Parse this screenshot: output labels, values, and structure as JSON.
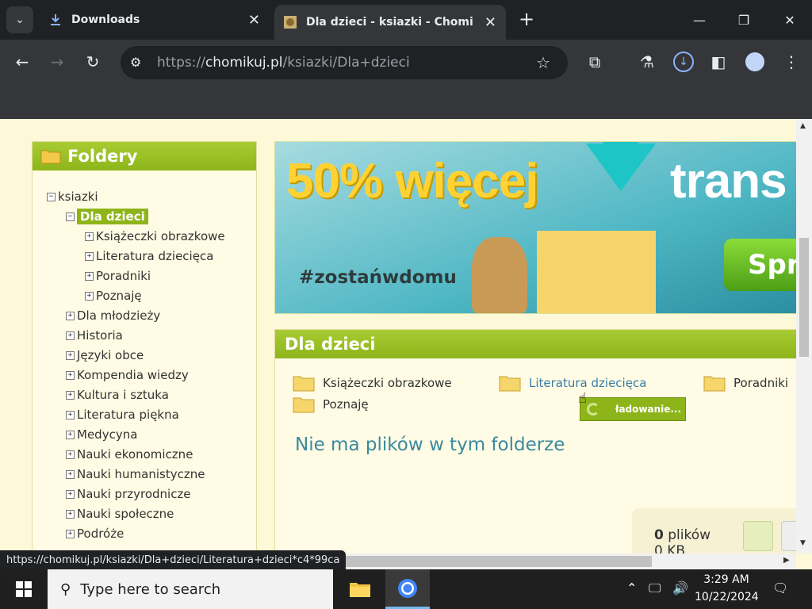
{
  "browser": {
    "tabs": [
      {
        "title": "Downloads"
      },
      {
        "title": "Dla dzieci - ksiazki - Chomikuj.pl"
      }
    ],
    "url_scheme": "https://",
    "url_host": "chomikuj.pl",
    "url_path": "/ksiazki/Dla+dzieci",
    "status_url": "https://chomikuj.pl/ksiazki/Dla+dzieci/Literatura+dzieci*c4*99ca"
  },
  "sidebar": {
    "title": "Foldery",
    "tree": [
      {
        "label": "ksiazki",
        "sign": "−"
      },
      {
        "label": "Dla dzieci",
        "sign": "−"
      },
      {
        "label": "Książeczki obrazkowe",
        "sign": "+"
      },
      {
        "label": "Literatura dziecięca",
        "sign": "+"
      },
      {
        "label": "Poradniki",
        "sign": "+"
      },
      {
        "label": "Poznaję",
        "sign": "+"
      },
      {
        "label": "Dla młodzieży",
        "sign": "+"
      },
      {
        "label": "Historia",
        "sign": "+"
      },
      {
        "label": "Języki obce",
        "sign": "+"
      },
      {
        "label": "Kompendia wiedzy",
        "sign": "+"
      },
      {
        "label": "Kultura i sztuka",
        "sign": "+"
      },
      {
        "label": "Literatura piękna",
        "sign": "+"
      },
      {
        "label": "Medycyna",
        "sign": "+"
      },
      {
        "label": "Nauki ekonomiczne",
        "sign": "+"
      },
      {
        "label": "Nauki humanistyczne",
        "sign": "+"
      },
      {
        "label": "Nauki przyrodnicze",
        "sign": "+"
      },
      {
        "label": "Nauki społeczne",
        "sign": "+"
      },
      {
        "label": "Podróże",
        "sign": "+"
      }
    ]
  },
  "banner": {
    "headline_1": "50% więcej",
    "headline_2": "trans",
    "hashtag": "#zostańwdomu",
    "button": "Spr"
  },
  "content": {
    "title": "Dla dzieci",
    "folders": [
      "Książeczki obrazkowe",
      "Literatura dziecięca",
      "Poradniki",
      "Poznaję"
    ],
    "loading": "ładowanie...",
    "empty_message": "Nie ma plików w tym folderze",
    "files_count": "0",
    "files_label": "plików",
    "size": "0 KB"
  },
  "taskbar": {
    "search_placeholder": "Type here to search",
    "time": "3:29 AM",
    "date": "10/22/2024"
  },
  "colors": {
    "accent_green": "#8db51a",
    "page_bg": "#fdf8d8",
    "link_blue": "#3a7da8"
  }
}
